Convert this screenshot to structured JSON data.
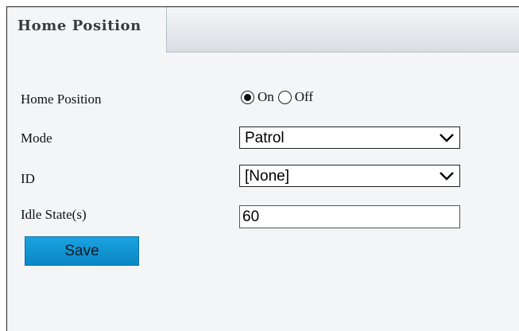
{
  "tab": {
    "label": "Home Position"
  },
  "form": {
    "home_position": {
      "label": "Home Position",
      "options": [
        "On",
        "Off"
      ],
      "selected": "On"
    },
    "mode": {
      "label": "Mode",
      "value": "Patrol"
    },
    "id": {
      "label": "ID",
      "value": "[None]"
    },
    "idle_state": {
      "label": "Idle State(s)",
      "value": "60"
    }
  },
  "save_label": "Save",
  "icons": {
    "radio_on": "radio-checked-icon",
    "radio_off": "radio-unchecked-icon",
    "dropdown": "chevron-down-icon"
  },
  "colors": {
    "save_button": "#1a9ad6",
    "panel_background": "#f3f5f7"
  }
}
